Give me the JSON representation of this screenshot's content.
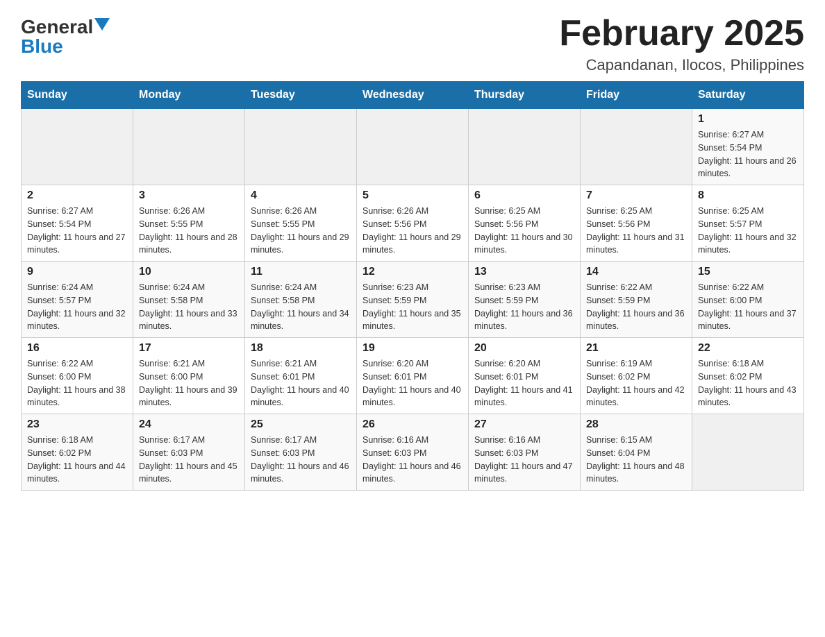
{
  "logo": {
    "general": "General",
    "blue": "Blue"
  },
  "title": "February 2025",
  "location": "Capandanan, Ilocos, Philippines",
  "days_of_week": [
    "Sunday",
    "Monday",
    "Tuesday",
    "Wednesday",
    "Thursday",
    "Friday",
    "Saturday"
  ],
  "weeks": [
    {
      "days": [
        {
          "number": "",
          "info": ""
        },
        {
          "number": "",
          "info": ""
        },
        {
          "number": "",
          "info": ""
        },
        {
          "number": "",
          "info": ""
        },
        {
          "number": "",
          "info": ""
        },
        {
          "number": "",
          "info": ""
        },
        {
          "number": "1",
          "info": "Sunrise: 6:27 AM\nSunset: 5:54 PM\nDaylight: 11 hours and 26 minutes."
        }
      ]
    },
    {
      "days": [
        {
          "number": "2",
          "info": "Sunrise: 6:27 AM\nSunset: 5:54 PM\nDaylight: 11 hours and 27 minutes."
        },
        {
          "number": "3",
          "info": "Sunrise: 6:26 AM\nSunset: 5:55 PM\nDaylight: 11 hours and 28 minutes."
        },
        {
          "number": "4",
          "info": "Sunrise: 6:26 AM\nSunset: 5:55 PM\nDaylight: 11 hours and 29 minutes."
        },
        {
          "number": "5",
          "info": "Sunrise: 6:26 AM\nSunset: 5:56 PM\nDaylight: 11 hours and 29 minutes."
        },
        {
          "number": "6",
          "info": "Sunrise: 6:25 AM\nSunset: 5:56 PM\nDaylight: 11 hours and 30 minutes."
        },
        {
          "number": "7",
          "info": "Sunrise: 6:25 AM\nSunset: 5:56 PM\nDaylight: 11 hours and 31 minutes."
        },
        {
          "number": "8",
          "info": "Sunrise: 6:25 AM\nSunset: 5:57 PM\nDaylight: 11 hours and 32 minutes."
        }
      ]
    },
    {
      "days": [
        {
          "number": "9",
          "info": "Sunrise: 6:24 AM\nSunset: 5:57 PM\nDaylight: 11 hours and 32 minutes."
        },
        {
          "number": "10",
          "info": "Sunrise: 6:24 AM\nSunset: 5:58 PM\nDaylight: 11 hours and 33 minutes."
        },
        {
          "number": "11",
          "info": "Sunrise: 6:24 AM\nSunset: 5:58 PM\nDaylight: 11 hours and 34 minutes."
        },
        {
          "number": "12",
          "info": "Sunrise: 6:23 AM\nSunset: 5:59 PM\nDaylight: 11 hours and 35 minutes."
        },
        {
          "number": "13",
          "info": "Sunrise: 6:23 AM\nSunset: 5:59 PM\nDaylight: 11 hours and 36 minutes."
        },
        {
          "number": "14",
          "info": "Sunrise: 6:22 AM\nSunset: 5:59 PM\nDaylight: 11 hours and 36 minutes."
        },
        {
          "number": "15",
          "info": "Sunrise: 6:22 AM\nSunset: 6:00 PM\nDaylight: 11 hours and 37 minutes."
        }
      ]
    },
    {
      "days": [
        {
          "number": "16",
          "info": "Sunrise: 6:22 AM\nSunset: 6:00 PM\nDaylight: 11 hours and 38 minutes."
        },
        {
          "number": "17",
          "info": "Sunrise: 6:21 AM\nSunset: 6:00 PM\nDaylight: 11 hours and 39 minutes."
        },
        {
          "number": "18",
          "info": "Sunrise: 6:21 AM\nSunset: 6:01 PM\nDaylight: 11 hours and 40 minutes."
        },
        {
          "number": "19",
          "info": "Sunrise: 6:20 AM\nSunset: 6:01 PM\nDaylight: 11 hours and 40 minutes."
        },
        {
          "number": "20",
          "info": "Sunrise: 6:20 AM\nSunset: 6:01 PM\nDaylight: 11 hours and 41 minutes."
        },
        {
          "number": "21",
          "info": "Sunrise: 6:19 AM\nSunset: 6:02 PM\nDaylight: 11 hours and 42 minutes."
        },
        {
          "number": "22",
          "info": "Sunrise: 6:18 AM\nSunset: 6:02 PM\nDaylight: 11 hours and 43 minutes."
        }
      ]
    },
    {
      "days": [
        {
          "number": "23",
          "info": "Sunrise: 6:18 AM\nSunset: 6:02 PM\nDaylight: 11 hours and 44 minutes."
        },
        {
          "number": "24",
          "info": "Sunrise: 6:17 AM\nSunset: 6:03 PM\nDaylight: 11 hours and 45 minutes."
        },
        {
          "number": "25",
          "info": "Sunrise: 6:17 AM\nSunset: 6:03 PM\nDaylight: 11 hours and 46 minutes."
        },
        {
          "number": "26",
          "info": "Sunrise: 6:16 AM\nSunset: 6:03 PM\nDaylight: 11 hours and 46 minutes."
        },
        {
          "number": "27",
          "info": "Sunrise: 6:16 AM\nSunset: 6:03 PM\nDaylight: 11 hours and 47 minutes."
        },
        {
          "number": "28",
          "info": "Sunrise: 6:15 AM\nSunset: 6:04 PM\nDaylight: 11 hours and 48 minutes."
        },
        {
          "number": "",
          "info": ""
        }
      ]
    }
  ]
}
